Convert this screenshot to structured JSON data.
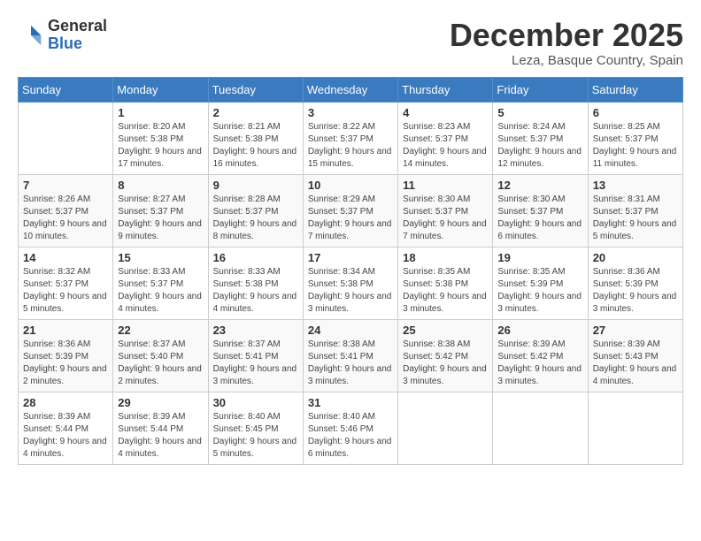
{
  "logo": {
    "general": "General",
    "blue": "Blue"
  },
  "title": "December 2025",
  "location": "Leza, Basque Country, Spain",
  "weekdays": [
    "Sunday",
    "Monday",
    "Tuesday",
    "Wednesday",
    "Thursday",
    "Friday",
    "Saturday"
  ],
  "weeks": [
    [
      {
        "day": "",
        "sunrise": "",
        "sunset": "",
        "daylight": ""
      },
      {
        "day": "1",
        "sunrise": "Sunrise: 8:20 AM",
        "sunset": "Sunset: 5:38 PM",
        "daylight": "Daylight: 9 hours and 17 minutes."
      },
      {
        "day": "2",
        "sunrise": "Sunrise: 8:21 AM",
        "sunset": "Sunset: 5:38 PM",
        "daylight": "Daylight: 9 hours and 16 minutes."
      },
      {
        "day": "3",
        "sunrise": "Sunrise: 8:22 AM",
        "sunset": "Sunset: 5:37 PM",
        "daylight": "Daylight: 9 hours and 15 minutes."
      },
      {
        "day": "4",
        "sunrise": "Sunrise: 8:23 AM",
        "sunset": "Sunset: 5:37 PM",
        "daylight": "Daylight: 9 hours and 14 minutes."
      },
      {
        "day": "5",
        "sunrise": "Sunrise: 8:24 AM",
        "sunset": "Sunset: 5:37 PM",
        "daylight": "Daylight: 9 hours and 12 minutes."
      },
      {
        "day": "6",
        "sunrise": "Sunrise: 8:25 AM",
        "sunset": "Sunset: 5:37 PM",
        "daylight": "Daylight: 9 hours and 11 minutes."
      }
    ],
    [
      {
        "day": "7",
        "sunrise": "Sunrise: 8:26 AM",
        "sunset": "Sunset: 5:37 PM",
        "daylight": "Daylight: 9 hours and 10 minutes."
      },
      {
        "day": "8",
        "sunrise": "Sunrise: 8:27 AM",
        "sunset": "Sunset: 5:37 PM",
        "daylight": "Daylight: 9 hours and 9 minutes."
      },
      {
        "day": "9",
        "sunrise": "Sunrise: 8:28 AM",
        "sunset": "Sunset: 5:37 PM",
        "daylight": "Daylight: 9 hours and 8 minutes."
      },
      {
        "day": "10",
        "sunrise": "Sunrise: 8:29 AM",
        "sunset": "Sunset: 5:37 PM",
        "daylight": "Daylight: 9 hours and 7 minutes."
      },
      {
        "day": "11",
        "sunrise": "Sunrise: 8:30 AM",
        "sunset": "Sunset: 5:37 PM",
        "daylight": "Daylight: 9 hours and 7 minutes."
      },
      {
        "day": "12",
        "sunrise": "Sunrise: 8:30 AM",
        "sunset": "Sunset: 5:37 PM",
        "daylight": "Daylight: 9 hours and 6 minutes."
      },
      {
        "day": "13",
        "sunrise": "Sunrise: 8:31 AM",
        "sunset": "Sunset: 5:37 PM",
        "daylight": "Daylight: 9 hours and 5 minutes."
      }
    ],
    [
      {
        "day": "14",
        "sunrise": "Sunrise: 8:32 AM",
        "sunset": "Sunset: 5:37 PM",
        "daylight": "Daylight: 9 hours and 5 minutes."
      },
      {
        "day": "15",
        "sunrise": "Sunrise: 8:33 AM",
        "sunset": "Sunset: 5:37 PM",
        "daylight": "Daylight: 9 hours and 4 minutes."
      },
      {
        "day": "16",
        "sunrise": "Sunrise: 8:33 AM",
        "sunset": "Sunset: 5:38 PM",
        "daylight": "Daylight: 9 hours and 4 minutes."
      },
      {
        "day": "17",
        "sunrise": "Sunrise: 8:34 AM",
        "sunset": "Sunset: 5:38 PM",
        "daylight": "Daylight: 9 hours and 3 minutes."
      },
      {
        "day": "18",
        "sunrise": "Sunrise: 8:35 AM",
        "sunset": "Sunset: 5:38 PM",
        "daylight": "Daylight: 9 hours and 3 minutes."
      },
      {
        "day": "19",
        "sunrise": "Sunrise: 8:35 AM",
        "sunset": "Sunset: 5:39 PM",
        "daylight": "Daylight: 9 hours and 3 minutes."
      },
      {
        "day": "20",
        "sunrise": "Sunrise: 8:36 AM",
        "sunset": "Sunset: 5:39 PM",
        "daylight": "Daylight: 9 hours and 3 minutes."
      }
    ],
    [
      {
        "day": "21",
        "sunrise": "Sunrise: 8:36 AM",
        "sunset": "Sunset: 5:39 PM",
        "daylight": "Daylight: 9 hours and 2 minutes."
      },
      {
        "day": "22",
        "sunrise": "Sunrise: 8:37 AM",
        "sunset": "Sunset: 5:40 PM",
        "daylight": "Daylight: 9 hours and 2 minutes."
      },
      {
        "day": "23",
        "sunrise": "Sunrise: 8:37 AM",
        "sunset": "Sunset: 5:41 PM",
        "daylight": "Daylight: 9 hours and 3 minutes."
      },
      {
        "day": "24",
        "sunrise": "Sunrise: 8:38 AM",
        "sunset": "Sunset: 5:41 PM",
        "daylight": "Daylight: 9 hours and 3 minutes."
      },
      {
        "day": "25",
        "sunrise": "Sunrise: 8:38 AM",
        "sunset": "Sunset: 5:42 PM",
        "daylight": "Daylight: 9 hours and 3 minutes."
      },
      {
        "day": "26",
        "sunrise": "Sunrise: 8:39 AM",
        "sunset": "Sunset: 5:42 PM",
        "daylight": "Daylight: 9 hours and 3 minutes."
      },
      {
        "day": "27",
        "sunrise": "Sunrise: 8:39 AM",
        "sunset": "Sunset: 5:43 PM",
        "daylight": "Daylight: 9 hours and 4 minutes."
      }
    ],
    [
      {
        "day": "28",
        "sunrise": "Sunrise: 8:39 AM",
        "sunset": "Sunset: 5:44 PM",
        "daylight": "Daylight: 9 hours and 4 minutes."
      },
      {
        "day": "29",
        "sunrise": "Sunrise: 8:39 AM",
        "sunset": "Sunset: 5:44 PM",
        "daylight": "Daylight: 9 hours and 4 minutes."
      },
      {
        "day": "30",
        "sunrise": "Sunrise: 8:40 AM",
        "sunset": "Sunset: 5:45 PM",
        "daylight": "Daylight: 9 hours and 5 minutes."
      },
      {
        "day": "31",
        "sunrise": "Sunrise: 8:40 AM",
        "sunset": "Sunset: 5:46 PM",
        "daylight": "Daylight: 9 hours and 6 minutes."
      },
      {
        "day": "",
        "sunrise": "",
        "sunset": "",
        "daylight": ""
      },
      {
        "day": "",
        "sunrise": "",
        "sunset": "",
        "daylight": ""
      },
      {
        "day": "",
        "sunrise": "",
        "sunset": "",
        "daylight": ""
      }
    ]
  ]
}
